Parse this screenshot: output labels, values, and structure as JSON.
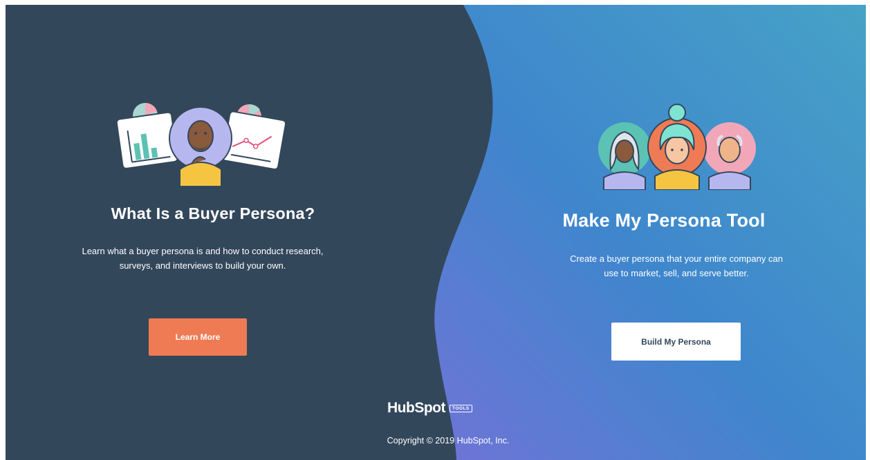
{
  "left_panel": {
    "title": "What Is a Buyer Persona?",
    "description": "Learn what a buyer persona is and how to conduct research, surveys, and interviews to build your own.",
    "button_label": "Learn More"
  },
  "right_panel": {
    "title": "Make My Persona Tool",
    "description": "Create a buyer persona that your entire company can use to market, sell, and serve better.",
    "button_label": "Build My Persona"
  },
  "footer": {
    "logo_text": "HubSpot",
    "logo_badge": "TOOLS",
    "copyright": "Copyright © 2019 HubSpot, Inc."
  },
  "colors": {
    "left_background": "#33475b",
    "right_gradient": [
      "#45a0c8",
      "#3a86cc",
      "#5a78d0"
    ],
    "learn_button": "#ef7b54",
    "build_button": "#ffffff"
  },
  "icons": [
    "buyer-persona-illustration",
    "persona-group-illustration",
    "hubspot-logo"
  ]
}
